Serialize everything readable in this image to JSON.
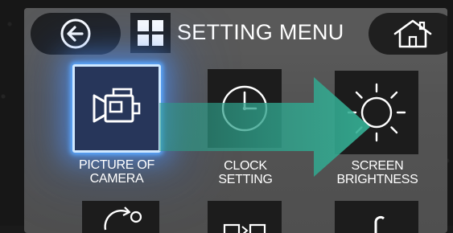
{
  "header": {
    "title": "SETTING MENU",
    "back_icon": "back-arrow-icon",
    "menu_icon": "grid-menu-icon",
    "home_icon": "home-icon"
  },
  "menu_items": [
    {
      "label_line1": "PICTURE OF",
      "label_line2": "CAMERA",
      "icon": "video-camera-icon",
      "selected": true
    },
    {
      "label_line1": "CLOCK",
      "label_line2": "SETTING",
      "icon": "clock-icon",
      "selected": false
    },
    {
      "label_line1": "SCREEN",
      "label_line2": "BRIGHTNESS",
      "icon": "sun-brightness-icon",
      "selected": false
    }
  ],
  "colors": {
    "panel": "#545454",
    "button_dark": "#1f1f1f",
    "selection_glow": "#5aa8ff",
    "arrow": "#2fa08a"
  }
}
